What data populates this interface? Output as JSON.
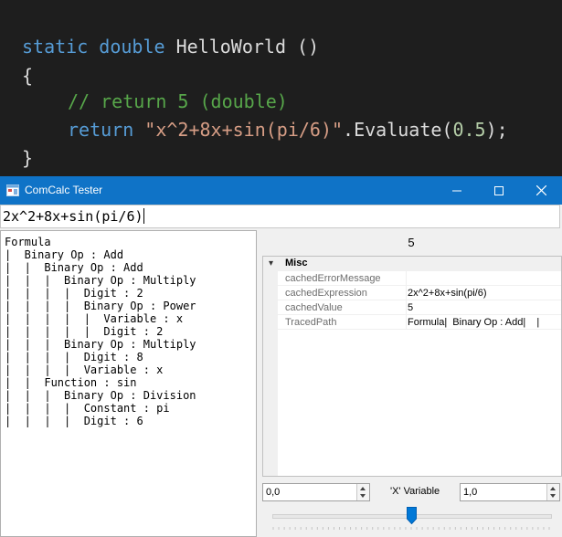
{
  "code": {
    "line1": {
      "kw1": "static",
      "kw2": "double",
      "name": "HelloWorld",
      "parens": " ()"
    },
    "line2": "{",
    "line3": "// return 5 (double)",
    "line4": {
      "kw": "return",
      "str": "\"x^2+8x+sin(pi/6)\"",
      "method": ".Evaluate(",
      "num": "0.5",
      "end": ");"
    },
    "line5": "}"
  },
  "window": {
    "title": "ComCalc Tester",
    "minimize_icon": "minimize-icon",
    "maximize_icon": "maximize-icon",
    "close_icon": "close-icon",
    "accent_color": "#0f73c7"
  },
  "formula_input": "2x^2+8x+sin(pi/6)",
  "tree": [
    "Formula",
    "|  Binary Op : Add",
    "|  |  Binary Op : Add",
    "|  |  |  Binary Op : Multiply",
    "|  |  |  |  Digit : 2",
    "|  |  |  |  Binary Op : Power",
    "|  |  |  |  |  Variable : x",
    "|  |  |  |  |  Digit : 2",
    "|  |  |  Binary Op : Multiply",
    "|  |  |  |  Digit : 8",
    "|  |  |  |  Variable : x",
    "|  |  Function : sin",
    "|  |  |  Binary Op : Division",
    "|  |  |  |  Constant : pi",
    "|  |  |  |  Digit : 6"
  ],
  "result": "5",
  "property_grid": {
    "category": "Misc",
    "rows": [
      {
        "name": "cachedErrorMessage",
        "value": ""
      },
      {
        "name": "cachedExpression",
        "value": "2x^2+8x+sin(pi/6)"
      },
      {
        "name": "cachedValue",
        "value": "5"
      },
      {
        "name": "TracedPath",
        "value": "Formula|  Binary Op : Add|    |"
      }
    ]
  },
  "range": {
    "min_value": "0,0",
    "variable_label": "'X' Variable",
    "max_value": "1,0",
    "slider_fraction": 0.5
  }
}
